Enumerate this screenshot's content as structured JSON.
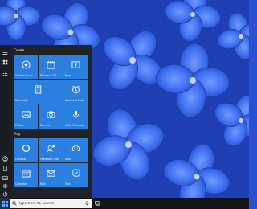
{
  "colors": {
    "accent": "#2b7fe0",
    "menu_bg": "#1f2327",
    "taskbar_bg": "#121418"
  },
  "rail": {
    "top": [
      {
        "icon": "hamburger-menu-icon"
      },
      {
        "icon": "tiles-icon"
      },
      {
        "icon": "list-icon"
      }
    ],
    "bottom": [
      {
        "icon": "user-avatar-icon"
      },
      {
        "icon": "document-icon"
      },
      {
        "icon": "pictures-icon"
      },
      {
        "icon": "settings-icon"
      },
      {
        "icon": "power-icon"
      }
    ]
  },
  "groups": [
    {
      "title": "Create",
      "tiles": [
        {
          "label": "Groove Music",
          "icon": "groove-music-icon"
        },
        {
          "label": "Movies & TV",
          "icon": "movies-tv-icon"
        },
        {
          "label": "Maps",
          "icon": "maps-icon"
        },
        {
          "label": "Calculator",
          "icon": "calculator-icon"
        },
        {
          "label": "Alarms & Clock",
          "icon": "alarm-clock-icon"
        },
        {
          "label": "Photos",
          "icon": "photos-icon"
        },
        {
          "label": "Camera",
          "icon": "camera-icon"
        },
        {
          "label": "Voice Recorder",
          "icon": "microphone-icon"
        }
      ]
    },
    {
      "title": "Play",
      "tiles": [
        {
          "label": "Cortana",
          "icon": "cortana-icon"
        },
        {
          "label": "Feedback Hub",
          "icon": "feedback-hub-icon"
        },
        {
          "label": "Xbox",
          "icon": "xbox-icon"
        },
        {
          "label": "Calendar",
          "icon": "calendar-icon"
        },
        {
          "label": "Mail",
          "icon": "mail-icon"
        },
        {
          "label": "Tips",
          "icon": "tips-icon"
        }
      ]
    }
  ],
  "taskbar": {
    "search_placeholder": "Type here to search",
    "start_icon": "windows-logo-icon",
    "mic_icon": "microphone-icon",
    "taskview_icon": "task-view-icon"
  }
}
